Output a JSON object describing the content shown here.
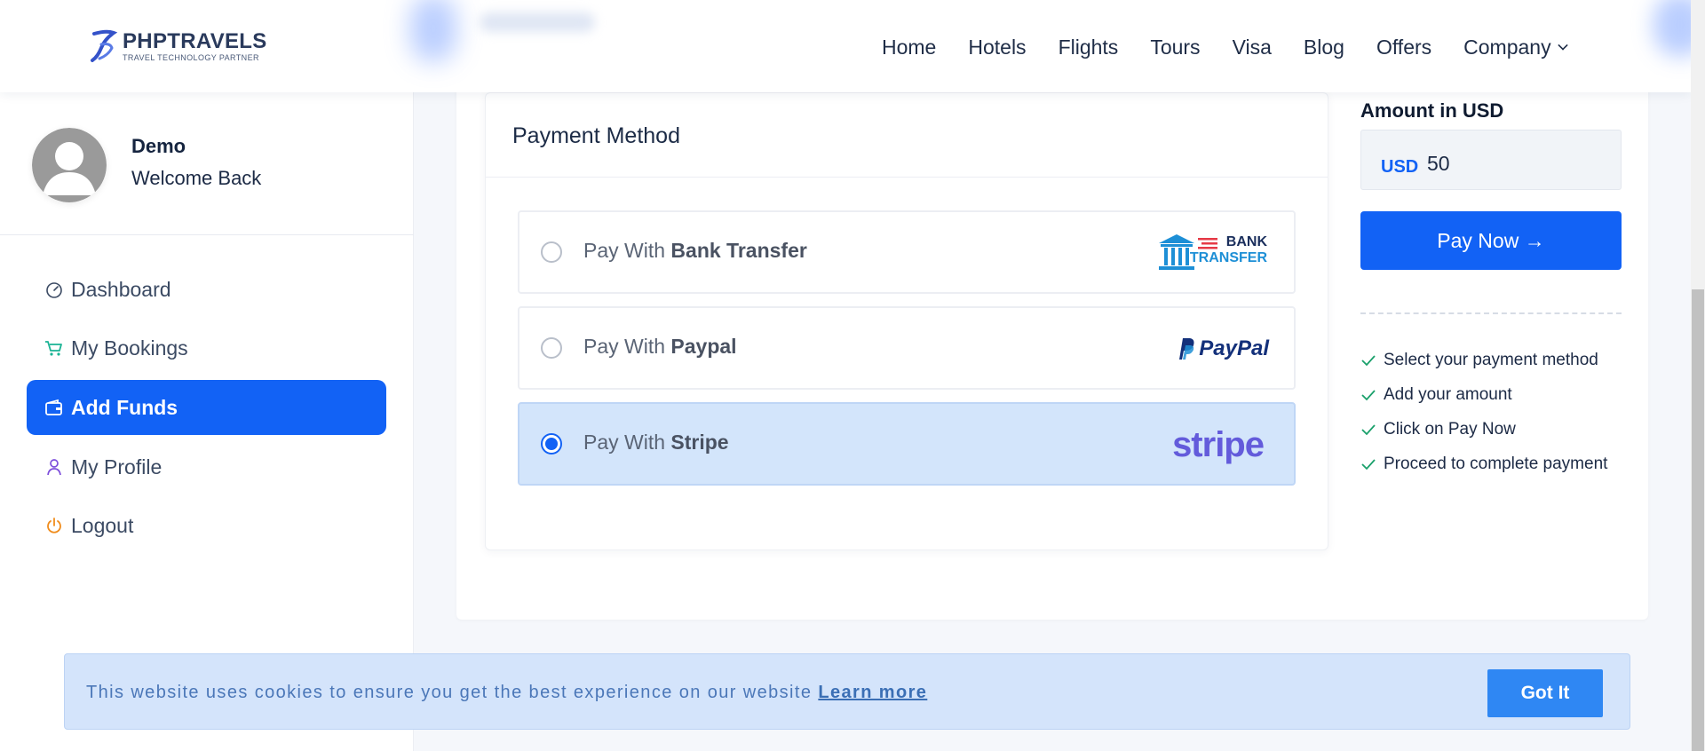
{
  "brand": {
    "name": "PHPTRAVELS",
    "tagline": "TRAVEL TECHNOLOGY PARTNER",
    "accent": "#1262f5"
  },
  "nav": {
    "items": [
      "Home",
      "Hotels",
      "Flights",
      "Tours",
      "Visa",
      "Blog",
      "Offers",
      "Company"
    ]
  },
  "sidebar": {
    "user_name": "Demo",
    "welcome": "Welcome Back",
    "menu": [
      {
        "label": "Dashboard",
        "icon": "gauge-icon"
      },
      {
        "label": "My Bookings",
        "icon": "cart-icon"
      },
      {
        "label": "Add Funds",
        "icon": "wallet-icon",
        "active": true
      },
      {
        "label": "My Profile",
        "icon": "user-icon"
      },
      {
        "label": "Logout",
        "icon": "power-icon"
      }
    ]
  },
  "payment": {
    "title": "Payment Method",
    "prefix": "Pay With",
    "options": [
      {
        "name": "Bank Transfer",
        "logo_text": [
          "BANK",
          "TRANSFER"
        ],
        "selected": false
      },
      {
        "name": "Paypal",
        "logo_text": "PayPal",
        "selected": false
      },
      {
        "name": "Stripe",
        "logo_text": "stripe",
        "selected": true
      }
    ]
  },
  "amount": {
    "label": "Amount in USD",
    "currency": "USD",
    "value": "50"
  },
  "pay_button": "Pay Now →",
  "steps": [
    "Select your payment method",
    "Add your amount",
    "Click on Pay Now",
    "Proceed to complete payment"
  ],
  "cookie": {
    "text": "This website uses cookies to ensure you get the best experience on our website",
    "link": "Learn more",
    "button": "Got It"
  }
}
